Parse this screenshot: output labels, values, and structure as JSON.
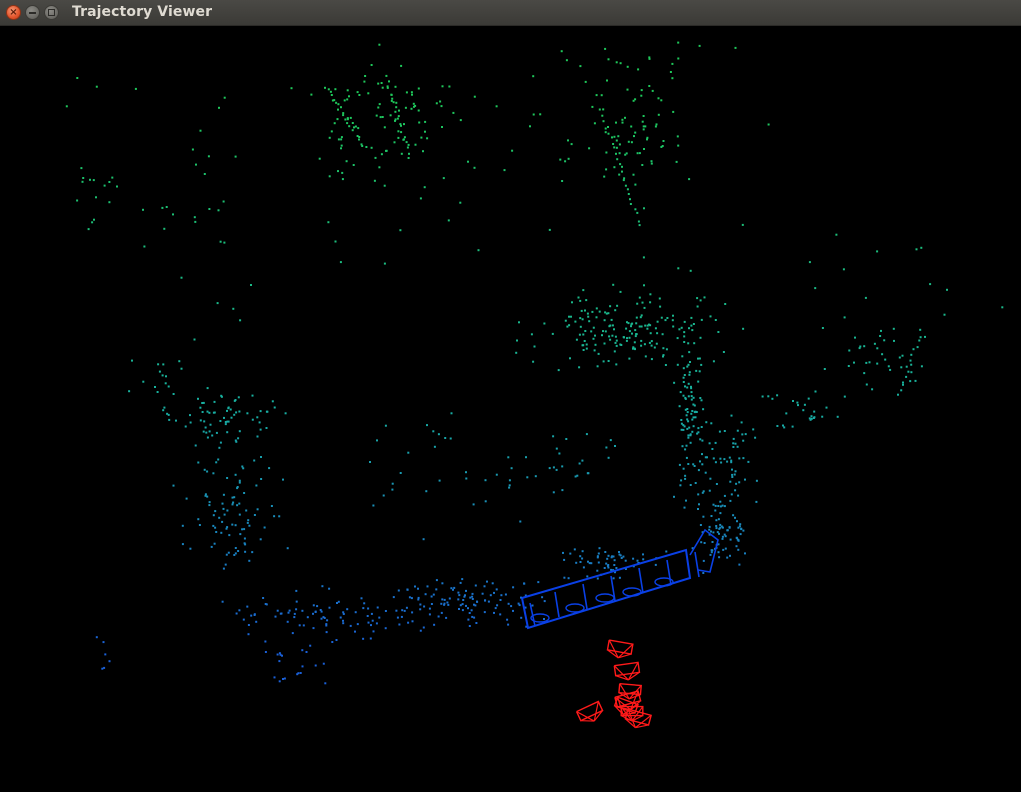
{
  "window": {
    "title": "Trajectory Viewer"
  },
  "viewer": {
    "background": "#000000",
    "map_point_colors": [
      "#1ec85a",
      "#18b0a0",
      "#1a60d8"
    ],
    "trajectory_color": "#0a40e6",
    "camera_color": "#ff1a1a"
  },
  "icons": {
    "close": "close-icon",
    "minimize": "minimize-icon",
    "maximize": "maximize-icon"
  }
}
